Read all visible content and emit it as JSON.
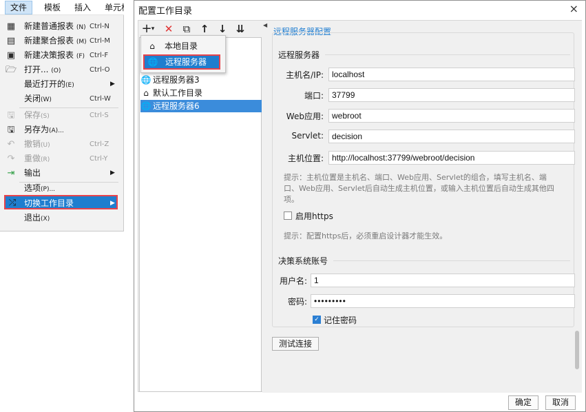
{
  "menubar": {
    "items": [
      "文件",
      "模板",
      "插入",
      "单元格"
    ]
  },
  "file_menu": {
    "items": [
      {
        "label": "新建普通报表",
        "shortcut_key": "(N)",
        "shortcut": "Ctrl-N",
        "icon": "grid-report-icon"
      },
      {
        "label": "新建聚合报表",
        "shortcut_key": "(M)",
        "shortcut": "Ctrl-M",
        "icon": "aggregate-report-icon"
      },
      {
        "label": "新建决策报表",
        "shortcut_key": "(F)",
        "shortcut": "Ctrl-F",
        "icon": "dashboard-report-icon"
      },
      {
        "label": "打开...",
        "shortcut_key": "(O)",
        "shortcut": "Ctrl-O",
        "icon": "folder-open-icon"
      },
      {
        "label": "最近打开的",
        "shortcut_key": "(E)"
      },
      {
        "label": "关闭",
        "shortcut_key": "(W)",
        "shortcut": "Ctrl-W"
      },
      {
        "label": "保存",
        "shortcut_key": "(S)",
        "shortcut": "Ctrl-S",
        "icon": "save-icon"
      },
      {
        "label": "另存为",
        "shortcut_key": "(A)...",
        "icon": "save-as-icon"
      },
      {
        "label": "撤销",
        "shortcut_key": "(U)",
        "shortcut": "Ctrl-Z",
        "icon": "undo-icon"
      },
      {
        "label": "重做",
        "shortcut_key": "(R)",
        "shortcut": "Ctrl-Y",
        "icon": "redo-icon"
      },
      {
        "label": "输出",
        "icon": "export-icon"
      },
      {
        "label": "选项",
        "shortcut_key": "(P)..."
      },
      {
        "label": "切换工作目录",
        "icon": "switch-icon"
      },
      {
        "label": "退出",
        "shortcut_key": "(X)"
      }
    ]
  },
  "dialog": {
    "title": "配置工作目录",
    "close": "×",
    "toolbar": {
      "add": "+",
      "add_caret": "▾",
      "delete": "✕",
      "copy": "⧉",
      "up": "↑",
      "down": "↓",
      "sort": "⇊"
    },
    "popup": {
      "items": [
        "本地目录",
        "远程服务器"
      ]
    },
    "tree": {
      "items": [
        "远程服务器3",
        "默认工作目录",
        "远程服务器6"
      ]
    },
    "panel": {
      "title": "远程服务器配置",
      "server_section": "远程服务器",
      "fields": {
        "host": {
          "label": "主机名/IP:",
          "value": "localhost"
        },
        "port": {
          "label": "端口:",
          "value": "37799"
        },
        "webapp": {
          "label": "Web应用:",
          "value": "webroot"
        },
        "servlet": {
          "label": "Servlet:",
          "value": "decision"
        },
        "location": {
          "label": "主机位置:",
          "value": "http://localhost:37799/webroot/decision"
        }
      },
      "hint1_line1": "提示：主机位置是主机名、端口、Web应用、Servlet的组合，填写主机名、端",
      "hint1_line2": "口、Web应用、Servlet后自动生成主机位置，或输入主机位置后自动生成其他四",
      "hint1_line3": "项。",
      "https_label": "启用https",
      "hint2": "提示：配置https后，必须重启设计器才能生效。",
      "account_section": "决策系统账号",
      "username": {
        "label": "用户名:",
        "value": "1"
      },
      "password": {
        "label": "密码:",
        "value": "•••••••••"
      },
      "remember_label": "记住密码",
      "test_button": "测试连接"
    },
    "ok": "确定",
    "cancel": "取消"
  }
}
